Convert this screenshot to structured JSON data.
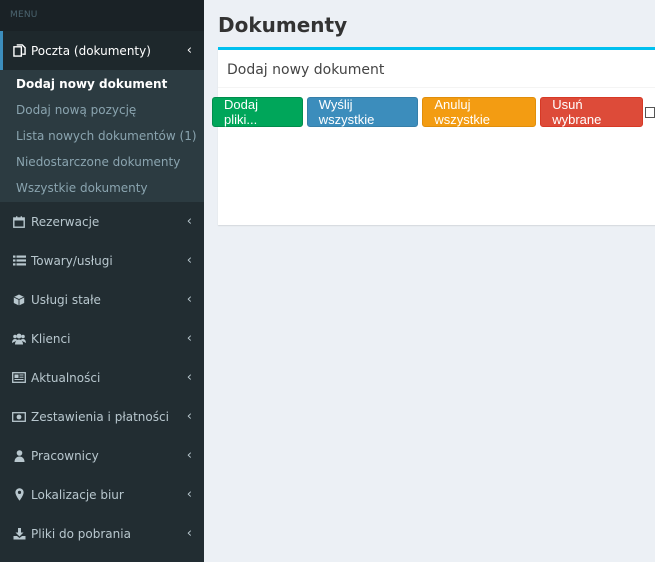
{
  "sidebar": {
    "header": "MENU",
    "active_item": {
      "label": "Poczta (dokumenty)",
      "icon": "documents-icon"
    },
    "submenu": [
      {
        "label": "Dodaj nowy dokument"
      },
      {
        "label": "Dodaj nową pozycję"
      },
      {
        "label": "Lista nowych dokumentów (1)"
      },
      {
        "label": "Niedostarczone dokumenty"
      },
      {
        "label": "Wszystkie dokumenty"
      }
    ],
    "items": [
      {
        "label": "Rezerwacje",
        "icon": "calendar-icon"
      },
      {
        "label": "Towary/usługi",
        "icon": "list-icon"
      },
      {
        "label": "Usługi stałe",
        "icon": "cube-icon"
      },
      {
        "label": "Klienci",
        "icon": "users-icon"
      },
      {
        "label": "Aktualności",
        "icon": "newspaper-icon"
      },
      {
        "label": "Zestawienia i płatności",
        "icon": "money-icon"
      },
      {
        "label": "Pracownicy",
        "icon": "user-icon"
      },
      {
        "label": "Lokalizacje biur",
        "icon": "map-marker-icon"
      },
      {
        "label": "Pliki do pobrania",
        "icon": "download-icon"
      }
    ]
  },
  "main": {
    "title": "Dokumenty",
    "box_title": "Dodaj nowy dokument",
    "buttons": {
      "add_files": "Dodaj pliki...",
      "send_all": "Wyślij wszystkie",
      "cancel_all": "Anuluj wszystkie",
      "delete_selected": "Usuń wybrane"
    },
    "select_all_checked": false
  },
  "colors": {
    "sidebar_bg": "#222d32",
    "accent": "#3c8dbc",
    "box_border": "#00c0ef",
    "success": "#00a65a",
    "warning": "#f39c12",
    "danger": "#dd4b39"
  }
}
